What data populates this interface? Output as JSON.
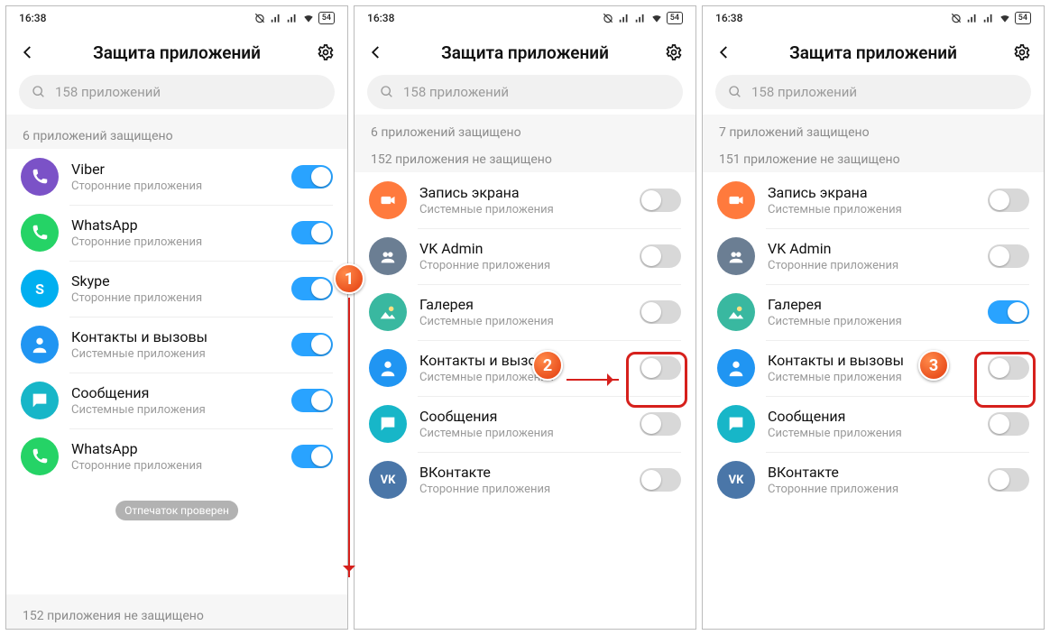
{
  "status": {
    "time": "16:38",
    "battery": "54"
  },
  "header": {
    "title": "Защита приложений"
  },
  "search": {
    "placeholder": "158 приложений"
  },
  "labels": {
    "protected6": "6 приложений защищено",
    "protected7": "7 приложений защищено",
    "unprotected152": "152 приложения не защищено",
    "unprotected151": "151 приложение не защищено",
    "third_party": "Сторонние приложения",
    "system": "Системные приложения"
  },
  "apps": {
    "viber": {
      "name": "Viber"
    },
    "whatsapp": {
      "name": "WhatsApp"
    },
    "skype": {
      "name": "Skype"
    },
    "contacts": {
      "name": "Контакты и вызовы"
    },
    "messages": {
      "name": "Сообщения"
    },
    "screenrec": {
      "name": "Запись экрана"
    },
    "vkadmin": {
      "name": "VK Admin"
    },
    "gallery": {
      "name": "Галерея"
    },
    "vk": {
      "name": "ВКонтакте"
    }
  },
  "toast": "Отпечаток проверен",
  "steps": {
    "s1": "1",
    "s2": "2",
    "s3": "3"
  },
  "icon_colors": {
    "viber": "#7b52c7",
    "whatsapp": "#25d366",
    "skype": "#00aff0",
    "contacts": "#2095f2",
    "messages": "#17b6c8",
    "screenrec": "#ff7a3d",
    "vkadmin": "#6b7e93",
    "gallery": "#39b8a0",
    "vk": "#4a76a8"
  }
}
